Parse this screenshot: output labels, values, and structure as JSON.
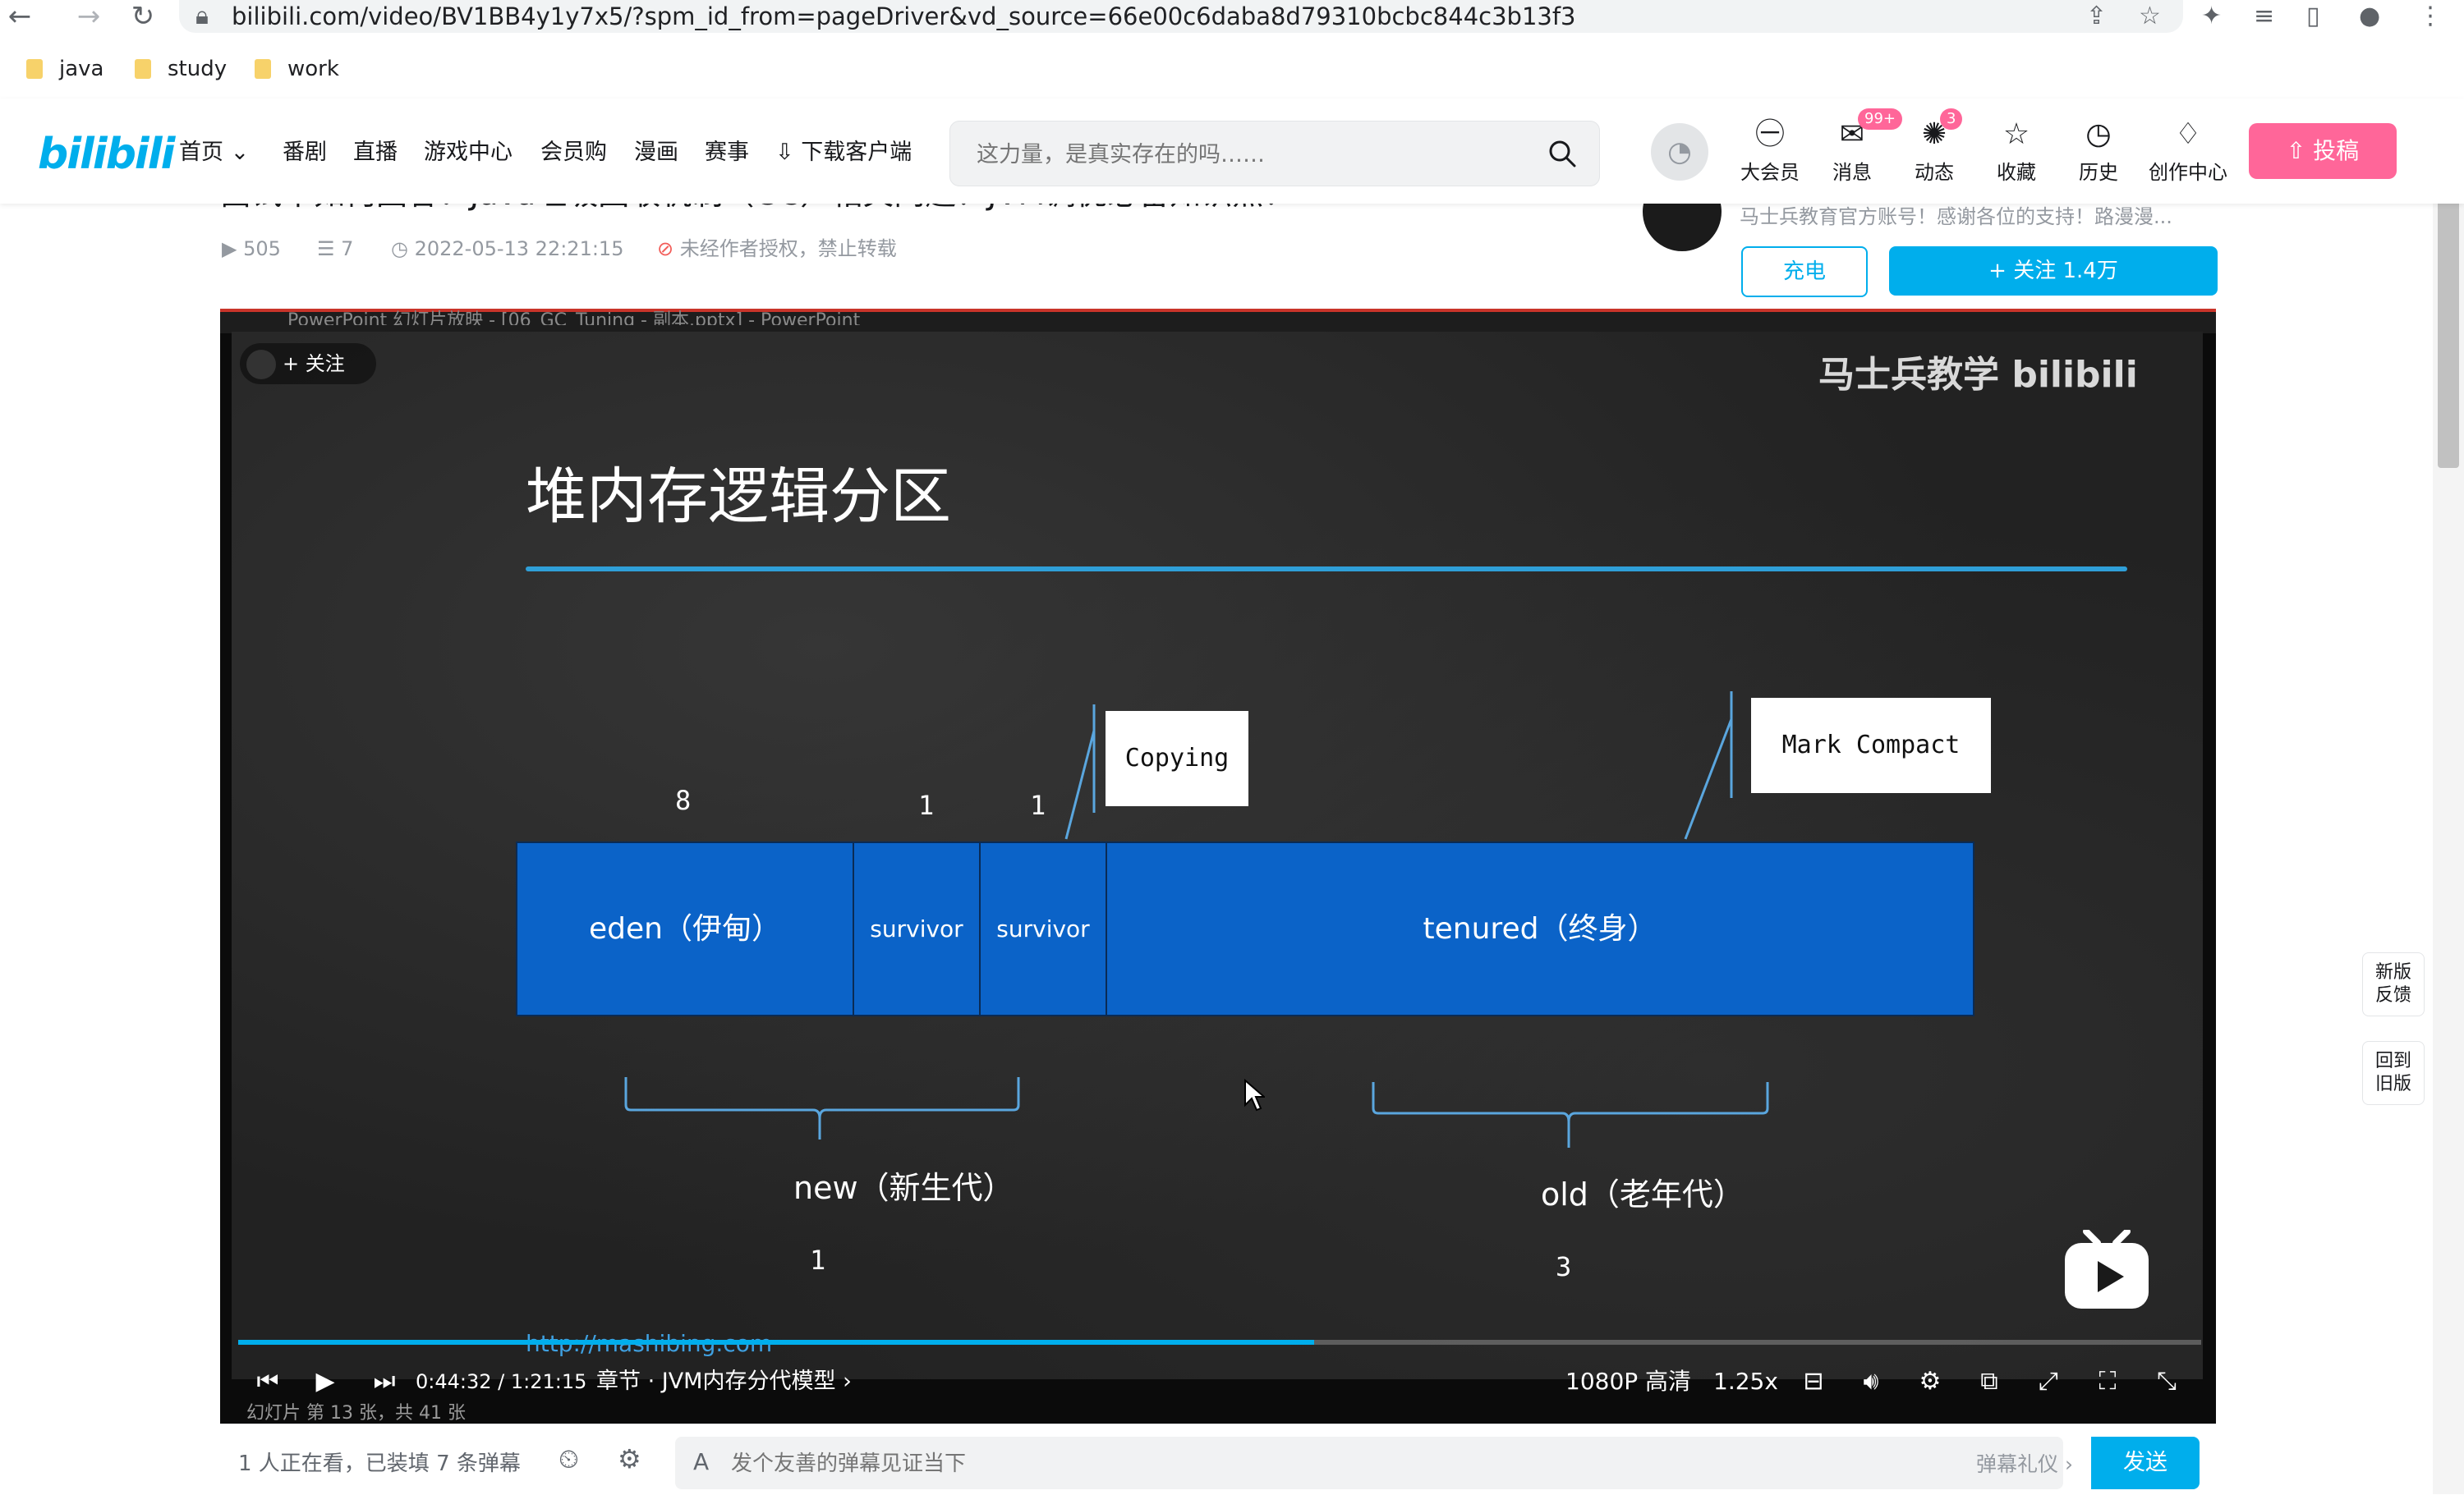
{
  "browser": {
    "url": "bilibili.com/video/BV1BB4y1y7x5/?spm_id_from=pageDriver&vd_source=66e00c6daba8d79310bcbc844c3b13f3",
    "bookmarks": [
      "java",
      "study",
      "work"
    ]
  },
  "header": {
    "logo": "bilibili",
    "nav": [
      "首页",
      "番剧",
      "直播",
      "游戏中心",
      "会员购",
      "漫画",
      "赛事",
      "下载客户端"
    ],
    "search_placeholder": "这力量，是真实存在的吗……",
    "icons": [
      {
        "label": "大会员",
        "icon": "vip-icon"
      },
      {
        "label": "消息",
        "icon": "message-icon",
        "badge": "99+"
      },
      {
        "label": "动态",
        "icon": "dynamic-icon",
        "badge": "3"
      },
      {
        "label": "收藏",
        "icon": "star-icon"
      },
      {
        "label": "历史",
        "icon": "clock-icon"
      },
      {
        "label": "创作中心",
        "icon": "bulb-icon"
      }
    ],
    "upload": "投稿"
  },
  "video": {
    "title_partial": "面试中如何回答：Java垃圾回收机制（GC）相关问题？JVM调优必备知识点！",
    "plays": "505",
    "danmaku_count": "7",
    "date": "2022-05-13 22:21:15",
    "copyright": "未经作者授权，禁止转载"
  },
  "uploader": {
    "desc": "马士兵教育官方账号！感谢各位的支持！路漫漫...",
    "charge": "充电",
    "follow": "关注 1.4万"
  },
  "player": {
    "ppt_window_title": "PowerPoint 幻灯片放映 - [06_GC_Tuning - 副本.pptx] - PowerPoint",
    "follow_chip": "关注",
    "watermark": "马士兵教学 bilibili",
    "current_time": "0:44:32",
    "total_time": "1:21:15",
    "progress": 0.548,
    "chapter": "章节 · JVM内存分代模型",
    "quality": "1080P 高清",
    "speed": "1.25x",
    "slide_status": "幻灯片 第 13 张，共 41 张"
  },
  "slide": {
    "title": "堆内存逻辑分区",
    "ratios": {
      "eden": "8",
      "s1": "1",
      "s2": "1"
    },
    "regions": {
      "eden": "eden（伊甸）",
      "s1": "survivor",
      "s2": "survivor",
      "tenured": "tenured（终身）"
    },
    "callouts": {
      "young": "Copying",
      "old": "Mark Compact"
    },
    "gens": {
      "new": "new（新生代）",
      "old": "old（老年代）"
    },
    "gen_ratio": {
      "new": "1",
      "old": "3"
    },
    "url": "http://mashibing.com"
  },
  "danmaku": {
    "viewers": "1 人正在看，已装填 7 条弹幕",
    "placeholder": "发个友善的弹幕见证当下",
    "etiquette": "弹幕礼仪",
    "send": "发送"
  },
  "float": {
    "feedback": "新版反馈",
    "old_version": "回到旧版"
  },
  "colors": {
    "brand_blue": "#00aeec",
    "brand_pink": "#ff6699",
    "region_blue": "#0b63c8"
  }
}
